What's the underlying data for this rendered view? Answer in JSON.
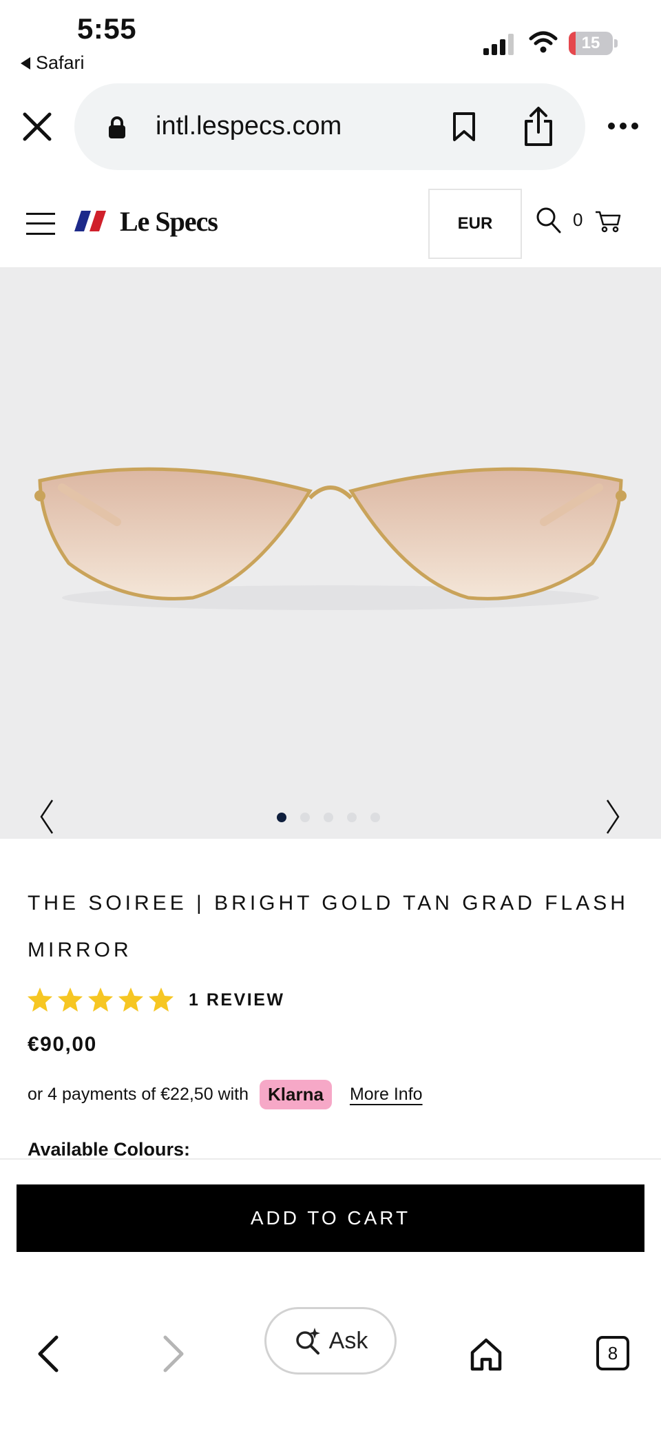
{
  "status_bar": {
    "time": "5:55",
    "back_app": "Safari",
    "battery_level": "15",
    "battery_fraction": 0.15
  },
  "browser": {
    "url": "intl.lespecs.com",
    "icons": [
      "close-icon",
      "lock-icon",
      "bookmark-icon",
      "share-icon",
      "more-icon"
    ]
  },
  "site_header": {
    "logo_text": "Le Specs",
    "currency": "EUR",
    "cart_count": "0",
    "colors": {
      "logo_blue": "#1d2a8a",
      "logo_red": "#d0202b"
    }
  },
  "gallery": {
    "slide_count": 5,
    "active_slide": 0,
    "colors": {
      "background": "#ececed",
      "dot_active": "#0f1f3d",
      "dot_inactive": "#dcdde0"
    }
  },
  "product": {
    "title": "THE SOIREE | BRIGHT GOLD TAN GRAD FLASH MIRROR",
    "rating": 5,
    "max_rating": 5,
    "review_count": "1 REVIEW",
    "price": "€90,00",
    "installments_text": "or 4 payments of €22,50 with",
    "klarna_label": "Klarna",
    "more_info_label": "More Info",
    "colours_label": "Available Colours:",
    "add_to_cart_label": "ADD TO CART",
    "colors": {
      "star": "#f6c623",
      "klarna": "#f6a8c7"
    }
  },
  "bottom_bar": {
    "ask_label": "Ask",
    "tab_count": "8"
  }
}
